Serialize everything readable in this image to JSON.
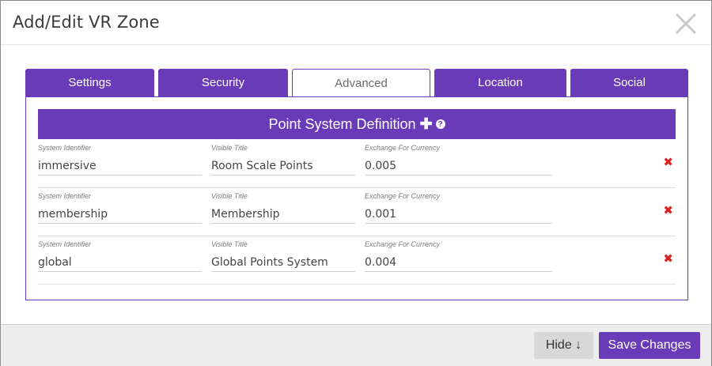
{
  "dialog": {
    "title": "Add/Edit VR Zone",
    "close_icon": "close-icon"
  },
  "tabs": [
    {
      "label": "Settings",
      "active": false
    },
    {
      "label": "Security",
      "active": false
    },
    {
      "label": "Advanced",
      "active": true
    },
    {
      "label": "Location",
      "active": false
    },
    {
      "label": "Social",
      "active": false
    }
  ],
  "section": {
    "title": "Point System Definition",
    "add_icon": "plus-icon",
    "help_icon": "help-icon",
    "labels": {
      "id": "System Identifier",
      "title": "Visible Title",
      "exchange": "Exchange For Currency"
    }
  },
  "rows": [
    {
      "id": "immersive",
      "title": "Room Scale Points",
      "exchange": "0.005"
    },
    {
      "id": "membership",
      "title": "Membership",
      "exchange": "0.001"
    },
    {
      "id": "global",
      "title": "Global Points System",
      "exchange": "0.004"
    }
  ],
  "footer": {
    "hide_label": "Hide ↓",
    "save_label": "Save Changes"
  },
  "colors": {
    "accent": "#6a3bb8",
    "delete": "#e02020"
  }
}
